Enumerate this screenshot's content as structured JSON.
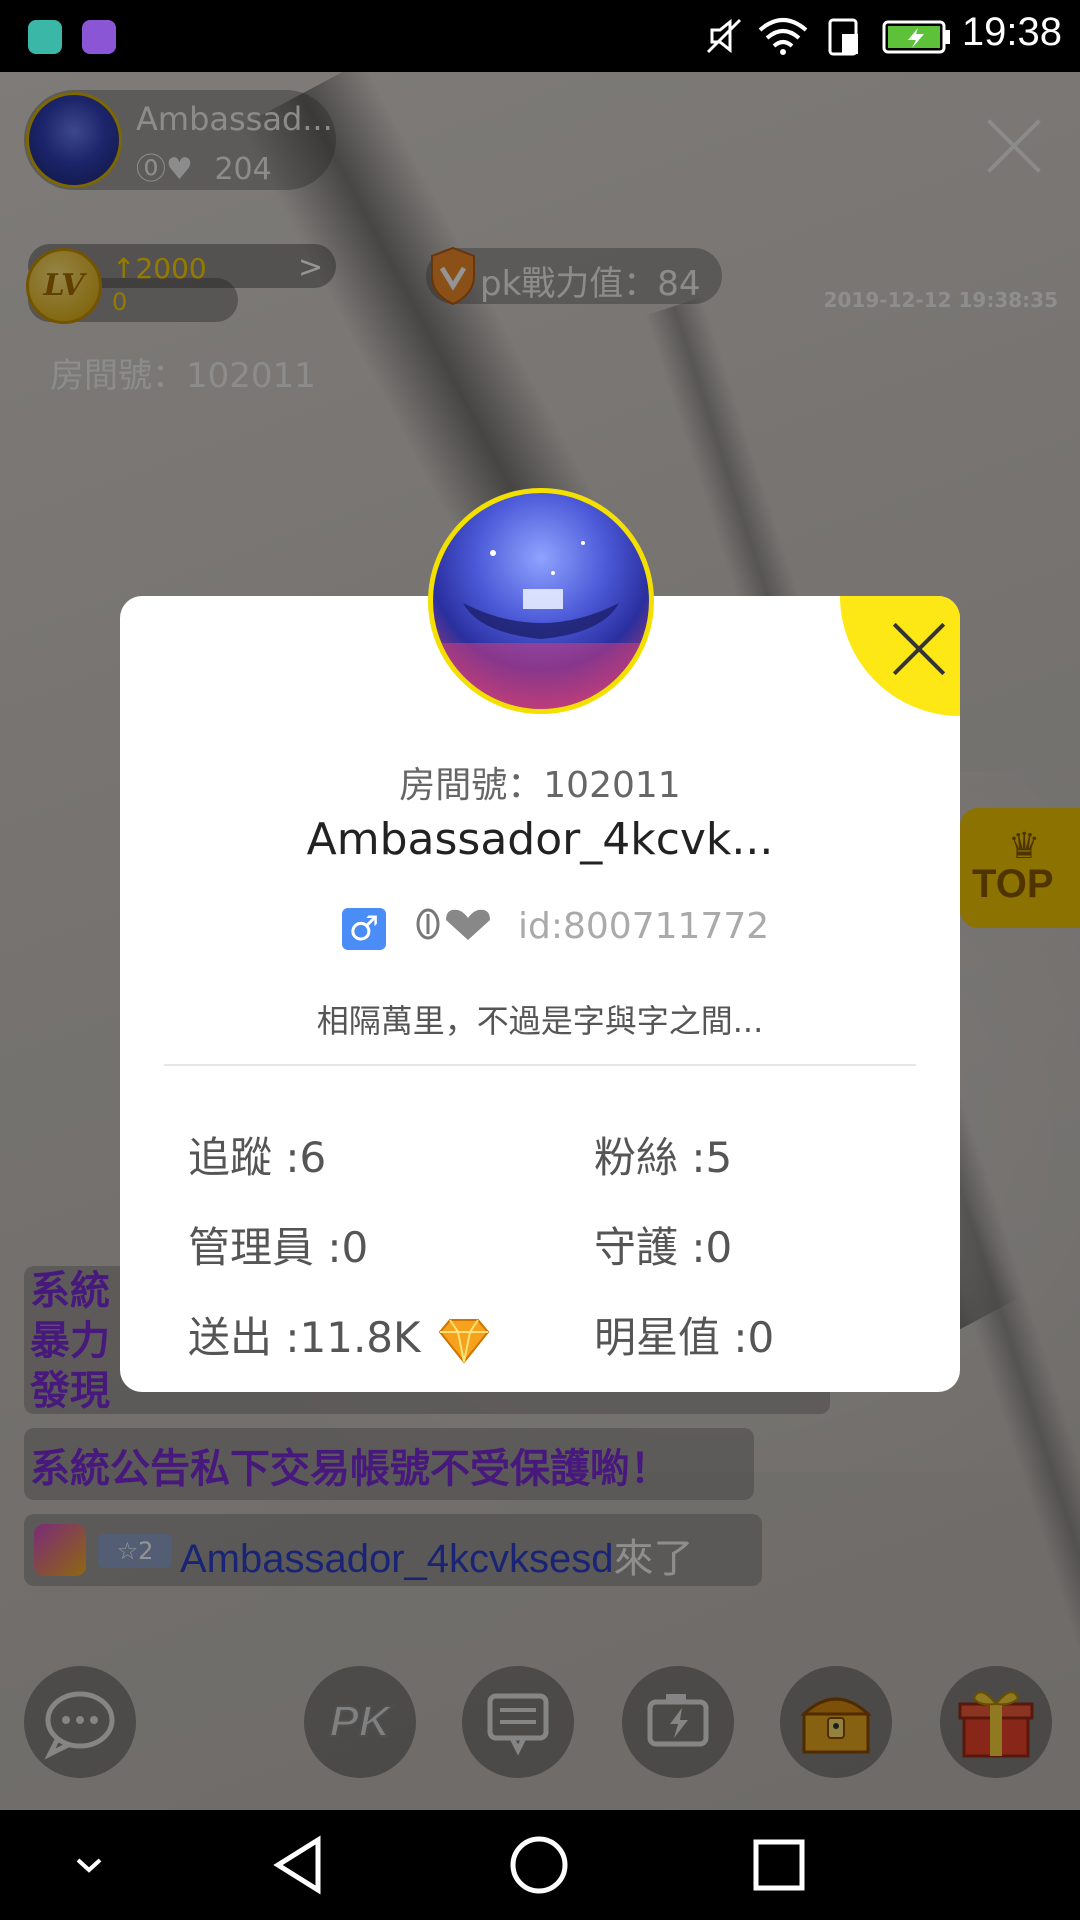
{
  "status_bar": {
    "time": "19:38"
  },
  "stream": {
    "host_name": "Ambassad...",
    "host_level_text": "204",
    "level_badge": "LV",
    "level_points": "2000",
    "level_zero": "0",
    "pk_label": "pk戰力值：84",
    "datetime": "2019-12-12 19:38:35",
    "room_number_text": "房間號：102011",
    "top_badge": "TOP",
    "chat": {
      "system_line1": "系統",
      "system_line2": "暴力",
      "system_line3": "發現",
      "system_notice": "系統公告私下交易帳號不受保護喲！",
      "enter_badge": "2",
      "enter_user": "Ambassador_4kcvksesd",
      "enter_suffix": "來了"
    }
  },
  "profile_card": {
    "room_number": "房間號：102011",
    "name": "Ambassador_4kcvk...",
    "gender_symbol": "♂",
    "user_id": "id:800711772",
    "signature": "相隔萬里，不過是字與字之間...",
    "stats": {
      "following": "追蹤 :6",
      "fans": "粉絲 :5",
      "admins": "管理員 :0",
      "guardians": "守護 :0",
      "sent": "送出 :11.8K",
      "star_value": "明星值 :0"
    }
  },
  "colors": {
    "modal_close": "#fde816",
    "system_text": "#7c2bd6",
    "gender_blue": "#4a8df6"
  }
}
